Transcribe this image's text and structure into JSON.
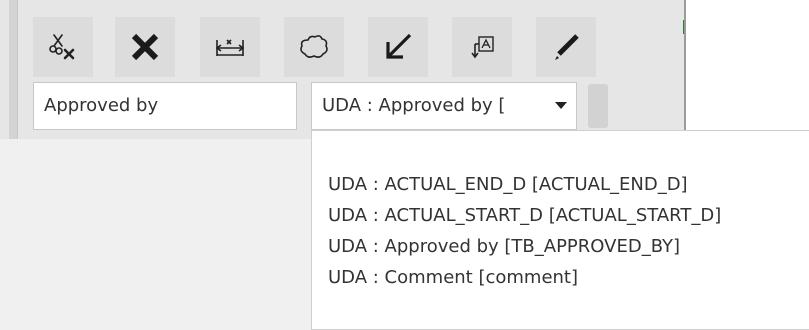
{
  "toolbar": {
    "buttons": [
      {
        "name": "clear-tool-button",
        "icon": "scissors-clear-icon"
      },
      {
        "name": "delete-button",
        "icon": "close-icon"
      },
      {
        "name": "dimension-button",
        "icon": "dimension-icon"
      },
      {
        "name": "cloud-button",
        "icon": "cloud-icon"
      },
      {
        "name": "leader-arrow-button",
        "icon": "arrow-down-left-icon"
      },
      {
        "name": "text-label-button",
        "icon": "text-label-icon"
      },
      {
        "name": "pen-button",
        "icon": "pencil-icon"
      }
    ]
  },
  "text_field": {
    "value": "Approved by"
  },
  "attribute_select": {
    "value": "UDA : Approved by [",
    "options": [
      "UDA : ACTUAL_END_D [ACTUAL_END_D]",
      "UDA : ACTUAL_START_D [ACTUAL_START_D]",
      "UDA : Approved by [TB_APPROVED_BY]",
      "UDA : Comment [comment]"
    ]
  },
  "colors": {
    "panel": "#e6e6e6",
    "button": "#dcdcdc",
    "icon": "#222222",
    "text": "#333333"
  }
}
